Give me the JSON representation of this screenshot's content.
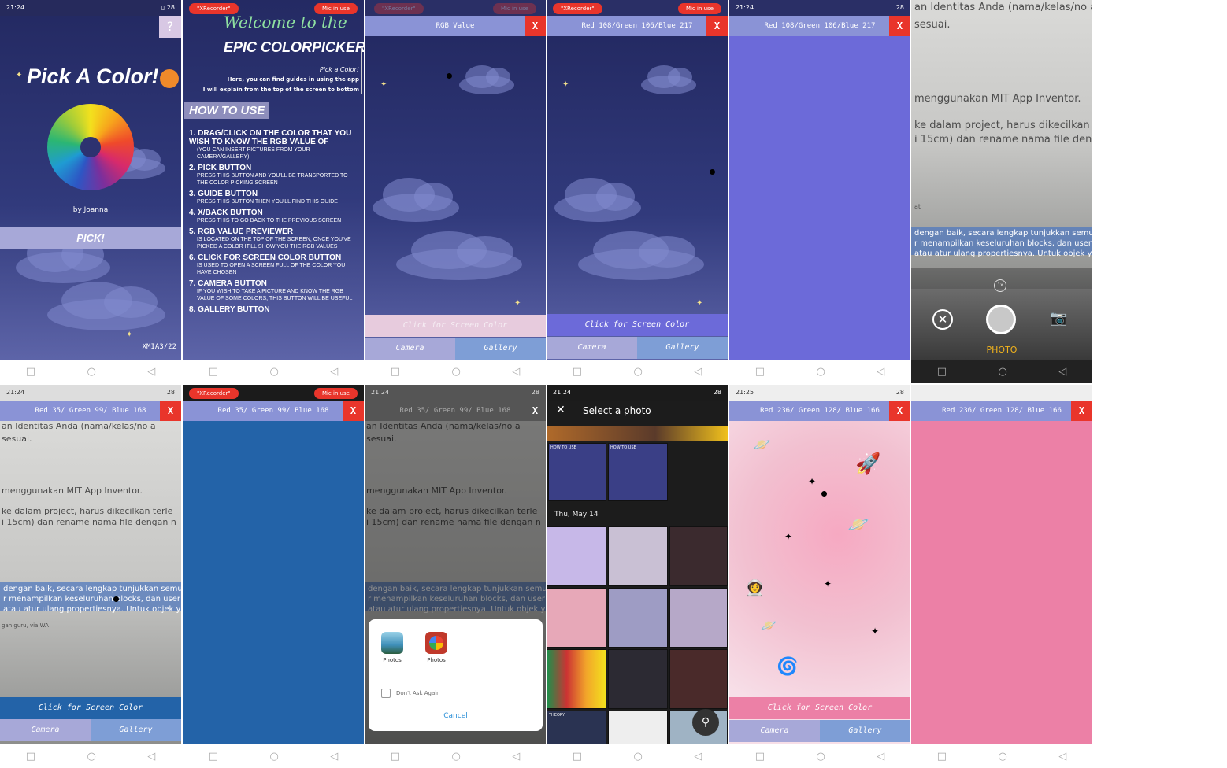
{
  "status": {
    "time": "21:24",
    "time2": "21:25",
    "battery": "28"
  },
  "recorder": {
    "label": "\"XRecorder\"",
    "mic": "Mic in use"
  },
  "title_screen": {
    "title": "Pick A Color!",
    "author": "by  Joanna",
    "pick": "PICK!",
    "class": "XMIA3/22",
    "help": "?"
  },
  "guide": {
    "welcome": "Welcome to the",
    "app": "EPIC COLORPICKER",
    "pick_hint": "Pick a Color!",
    "intro1": "Here, you can find guides in using the app",
    "intro2": "I will explain from the top of the screen to bottom",
    "how": "HOW TO USE",
    "items": [
      {
        "n": "1.",
        "h": "DRAG/CLICK ON THE COLOR THAT YOU WISH TO KNOW THE RGB VALUE OF",
        "b": "(YOU CAN INSERT PICTURES FROM YOUR CAMERA/GALLERY)"
      },
      {
        "n": "2.",
        "h": "PICK BUTTON",
        "b": "PRESS THIS BUTTON AND YOU'LL BE TRANSPORTED TO THE COLOR PICKING SCREEN"
      },
      {
        "n": "3.",
        "h": "GUIDE BUTTON",
        "b": "PRESS THIS BUTTON THEN YOU'LL FIND THIS GUIDE"
      },
      {
        "n": "4.",
        "h": "X/BACK BUTTON",
        "b": "PRESS THIS TO GO BACK TO THE PREVIOUS SCREEN"
      },
      {
        "n": "5.",
        "h": "RGB VALUE PREVIEWER",
        "b": "IS LOCATED ON THE TOP OF THE SCREEN, ONCE YOU'VE PICKED A COLOR IT'LL SHOW YOU THE RGB VALUES"
      },
      {
        "n": "6.",
        "h": "CLICK FOR SCREEN COLOR BUTTON",
        "b": "IS USED TO OPEN A SCREEN FULL OF THE COLOR YOU HAVE CHOSEN"
      },
      {
        "n": "7.",
        "h": "CAMERA BUTTON",
        "b": "IF YOU WISH TO TAKE A PICTURE AND KNOW THE RGB VALUE OF SOME COLORS, THIS BUTTON WILL BE USEFUL"
      },
      {
        "n": "8.",
        "h": "GALLERY BUTTON",
        "b": ""
      }
    ]
  },
  "picker": {
    "rgb_default": "RGB Value",
    "rgb_blue": "Red 108/Green 106/Blue 217",
    "rgb_dark": "Red 35/ Green 99/ Blue 168",
    "rgb_pink": "Red 236/ Green 128/ Blue 166",
    "close": "X",
    "screen_color": "Click for Screen Color",
    "camera": "Camera",
    "gallery": "Gallery"
  },
  "colors": {
    "c1": "#6c6ad9",
    "c2": "#2363a8",
    "c3": "#ec80a6"
  },
  "doc_text": {
    "l1": "an Identitas Anda (nama/kelas/no a",
    "l2": "sesuai.",
    "l3": "menggunakan MIT App Inventor.",
    "l4": "ke dalam project, harus dikecilkan terle",
    "l5": "i 15cm) dan rename nama file dengan n",
    "l6": "at",
    "l7": "dengan baik, secara lengkap tunjukkan semu",
    "l8": "r menampilkan keseluruhan blocks, dan user i",
    "l9": "atau atur ulang propertiesnya. Untuk objek yan",
    "l10": "gan guru, via WA"
  },
  "camera": {
    "zoom": "1x",
    "mode": "PHOTO"
  },
  "chooser": {
    "app1": "Photos",
    "app2": "Photos",
    "dont_ask": "Don't Ask Again",
    "cancel": "Cancel"
  },
  "gallery": {
    "title": "Select a photo",
    "date": "Thu, May 14",
    "thumb_label": "HOW TO USE",
    "theory": "THEORY"
  }
}
